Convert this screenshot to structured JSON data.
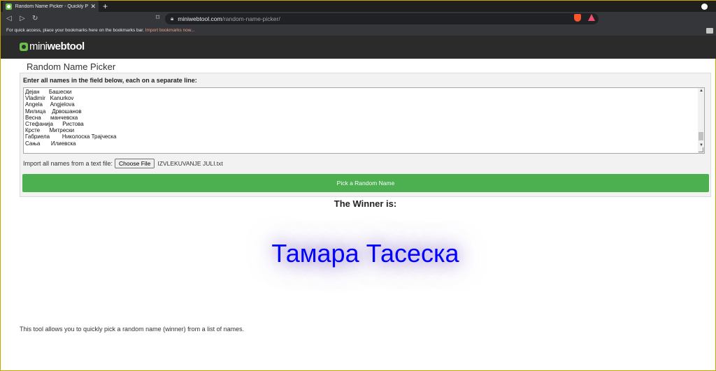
{
  "browser": {
    "tab_title": "Random Name Picker - Quickly P",
    "tab_close": "✕",
    "new_tab": "+",
    "url_host": "miniwebtool.com",
    "url_path": "/random-name-picker/",
    "bookmarks_prompt": "For quick access, place your bookmarks here on the bookmarks bar.",
    "bookmarks_import": "Import bookmarks now..."
  },
  "site": {
    "logo_mini": "mini",
    "logo_webtool": "webtool"
  },
  "page": {
    "title": "Random Name Picker",
    "instruction": "Enter all names in the field below, each on a separate line:",
    "names": [
      "Дејан      Башески",
      "Vladimir   Kanurkov",
      "Angela     Angjelova",
      "Милица    Дрвошанов",
      "Весна      манчевска",
      "Стефанија      Ристова",
      "Крсте      Митрески",
      "Габриела        Николоска Трајческа",
      "Сања       Илиевска"
    ],
    "import_label": "Import all names from a text file:",
    "choose_file_label": "Choose File",
    "file_name": "IZVLEKUVANJE JULI.txt",
    "pick_button": "Pick a Random Name",
    "winner_heading": "The Winner is:",
    "winner_name": "Тамара Тасеска",
    "footer": "This tool allows you to quickly pick a random name (winner) from a list of names."
  },
  "colors": {
    "accent_green": "#4caf50",
    "winner_blue": "#0000ff",
    "header_dark": "#2b2b2b"
  }
}
